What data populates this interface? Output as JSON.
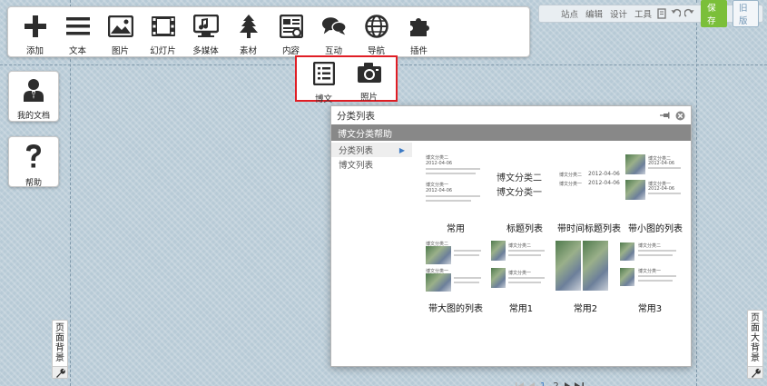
{
  "toolbar": {
    "items": [
      {
        "label": "添加",
        "icon": "plus-icon"
      },
      {
        "label": "文本",
        "icon": "text-lines-icon"
      },
      {
        "label": "图片",
        "icon": "image-icon"
      },
      {
        "label": "幻灯片",
        "icon": "filmstrip-icon"
      },
      {
        "label": "多媒体",
        "icon": "media-icon"
      },
      {
        "label": "素材",
        "icon": "tree-icon"
      },
      {
        "label": "内容",
        "icon": "content-icon"
      },
      {
        "label": "互动",
        "icon": "chat-bubbles-icon"
      },
      {
        "label": "导航",
        "icon": "globe-icon"
      },
      {
        "label": "插件",
        "icon": "puzzle-icon"
      }
    ]
  },
  "topright": {
    "links": [
      "站点",
      "编辑",
      "设计",
      "工具"
    ],
    "save": "保存",
    "old": "旧版"
  },
  "subbar": {
    "items": [
      {
        "label": "博文",
        "icon": "list-icon"
      },
      {
        "label": "照片",
        "icon": "camera-icon"
      }
    ]
  },
  "side": {
    "docs": "我的文档",
    "help": "帮助"
  },
  "vtabs": {
    "left": "页面背景",
    "right": "页面大背景"
  },
  "dialog": {
    "title": "分类列表",
    "help": "博文分类帮助",
    "menu": [
      {
        "label": "分类列表",
        "active": true
      },
      {
        "label": "博文列表",
        "active": false
      }
    ],
    "tiles": [
      {
        "label": "常用",
        "text_a": "博文分类二",
        "text_b": "博文分类一",
        "date": "2012-04-06"
      },
      {
        "label": "标题列表",
        "text_a": "博文分类二",
        "text_b": "博文分类一"
      },
      {
        "label": "带时间标题列表",
        "text_a": "博文分类二",
        "text_b": "博文分类一",
        "date": "2012-04-06"
      },
      {
        "label": "带小图的列表",
        "text_a": "博文分类二",
        "text_b": "博文分类一",
        "date": "2012-04-06"
      },
      {
        "label": "带大图的列表",
        "text_a": "博文分类二",
        "text_b": "博文分类一"
      },
      {
        "label": "常用1",
        "text_a": "博文分类二",
        "text_b": "博文分类一"
      },
      {
        "label": "常用2"
      },
      {
        "label": "常用3",
        "text_a": "博文分类二",
        "text_b": "博文分类一"
      }
    ],
    "pager": {
      "pages": [
        "1",
        "2"
      ],
      "current": "1"
    }
  }
}
